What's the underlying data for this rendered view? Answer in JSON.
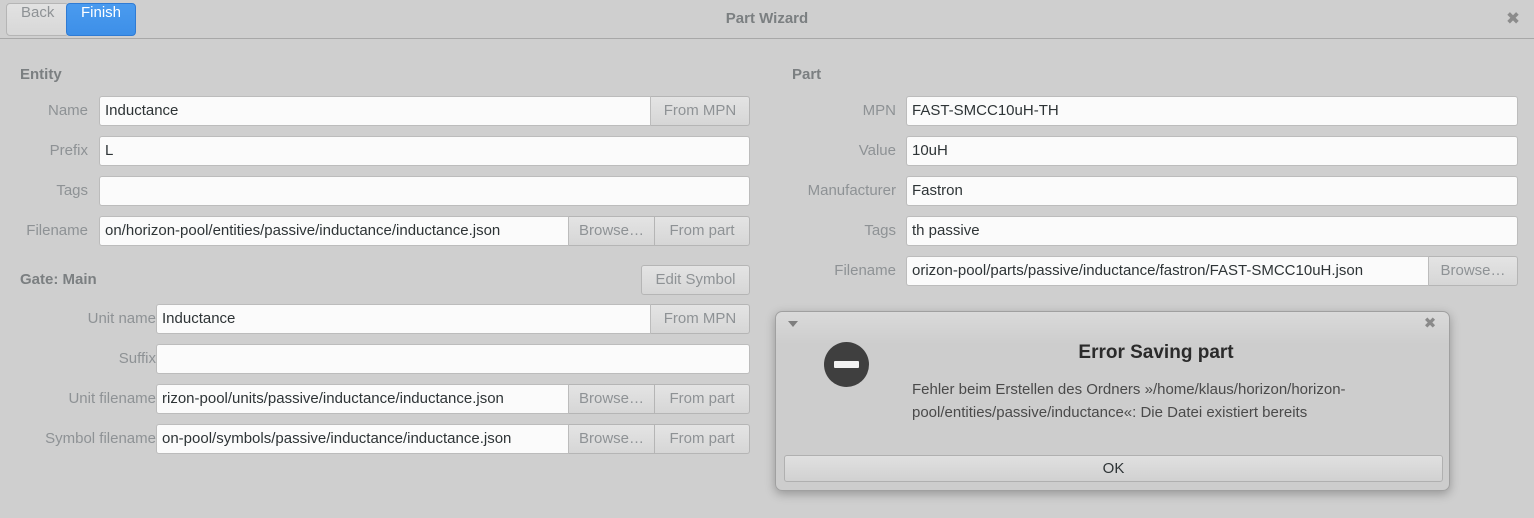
{
  "window": {
    "title": "Part Wizard",
    "back_label": "Back",
    "finish_label": "Finish",
    "close_icon": "✖",
    "accent_color": "#4a9bef"
  },
  "entity": {
    "section_title": "Entity",
    "rows": [
      {
        "label": "Name",
        "value": "Inductance",
        "placeholder": "",
        "buttons": [
          "From MPN"
        ]
      },
      {
        "label": "Prefix",
        "value": "L",
        "placeholder": "",
        "buttons": []
      },
      {
        "label": "Tags",
        "value": "",
        "placeholder": "",
        "buttons": []
      },
      {
        "label": "Filename",
        "value": "on/horizon-pool/entities/passive/inductance/inductance.json",
        "placeholder": "",
        "buttons": [
          "Browse…",
          "From part"
        ]
      }
    ]
  },
  "gate": {
    "section_title": "Gate: Main",
    "edit_symbol_label": "Edit Symbol",
    "rows": [
      {
        "label": "Unit name",
        "value": "Inductance",
        "placeholder": "",
        "buttons": [
          "From MPN"
        ]
      },
      {
        "label": "Suffix",
        "value": "",
        "placeholder": "",
        "buttons": []
      },
      {
        "label": "Unit filename",
        "value": "rizon-pool/units/passive/inductance/inductance.json",
        "placeholder": "",
        "buttons": [
          "Browse…",
          "From part"
        ]
      },
      {
        "label": "Symbol filename",
        "value": "on-pool/symbols/passive/inductance/inductance.json",
        "placeholder": "",
        "buttons": [
          "Browse…",
          "From part"
        ]
      }
    ]
  },
  "part": {
    "section_title": "Part",
    "rows": [
      {
        "label": "MPN",
        "value": "FAST-SMCC10uH-TH",
        "placeholder": "",
        "buttons": []
      },
      {
        "label": "Value",
        "value": "10uH",
        "placeholder": "",
        "buttons": []
      },
      {
        "label": "Manufacturer",
        "value": "Fastron",
        "placeholder": "",
        "buttons": []
      },
      {
        "label": "Tags",
        "value": "th passive",
        "placeholder": "",
        "buttons": []
      },
      {
        "label": "Filename",
        "value": "orizon-pool/parts/passive/inductance/fastron/FAST-SMCC10uH.json",
        "placeholder": "",
        "buttons": [
          "Browse…"
        ]
      }
    ]
  },
  "error_dialog": {
    "heading": "Error Saving part",
    "message": "Fehler beim Erstellen des Ordners »/home/klaus/horizon/horizon-pool/entities/passive/inductance«: Die Datei existiert bereits",
    "ok_label": "OK",
    "close_icon": "✖",
    "icon": "error-circle-icon"
  }
}
